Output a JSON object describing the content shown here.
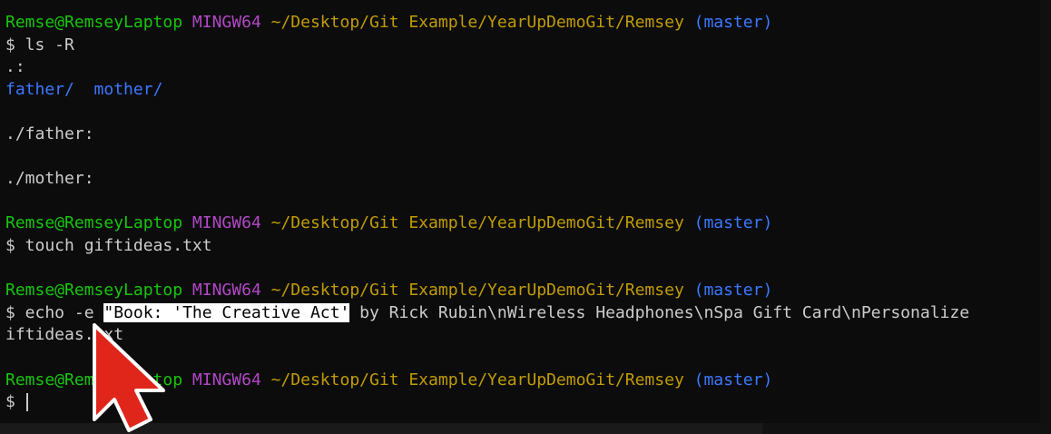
{
  "terminal": {
    "block1": {
      "user": "Remse@RemseyLaptop",
      "system": "MINGW64",
      "path": "~/Desktop/Git Example/YearUpDemoGit/Remsey",
      "branch": "(master)",
      "command": "$ ls -R",
      "out_dot": ".:",
      "dir_father": "father/",
      "dir_mother": "mother/",
      "out_father": "./father:",
      "out_mother": "./mother:"
    },
    "block2": {
      "user": "Remse@RemseyLaptop",
      "system": "MINGW64",
      "path": "~/Desktop/Git Example/YearUpDemoGit/Remsey",
      "branch": "(master)",
      "command": "$ touch giftideas.txt"
    },
    "block3": {
      "user": "Remse@RemseyLaptop",
      "system": "MINGW64",
      "path": "~/Desktop/Git Example/YearUpDemoGit/Remsey",
      "branch": "(master)",
      "command_prefix": "$ echo -e ",
      "command_highlight": "\"Book: 'The Creative Act'",
      "command_rest": " by Rick Rubin\\nWireless Headphones\\nSpa Gift Card\\nPersonalize",
      "command_wrap": "iftideas.txt"
    },
    "block4": {
      "user": "Remse@RemseyLaptop",
      "system": "MINGW64",
      "path": "~/Desktop/Git Example/YearUpDemoGit/Remsey",
      "branch": "(master)",
      "prompt": "$ "
    }
  },
  "colors": {
    "background": "#0c0c0c",
    "text": "#cccccc",
    "user": "#16c60c",
    "system": "#b148c6",
    "path": "#c19c00",
    "branch": "#3b78ff",
    "pointer": "#e0261b"
  },
  "icons": {
    "pointer": "mouse-pointer-arrow-icon"
  }
}
